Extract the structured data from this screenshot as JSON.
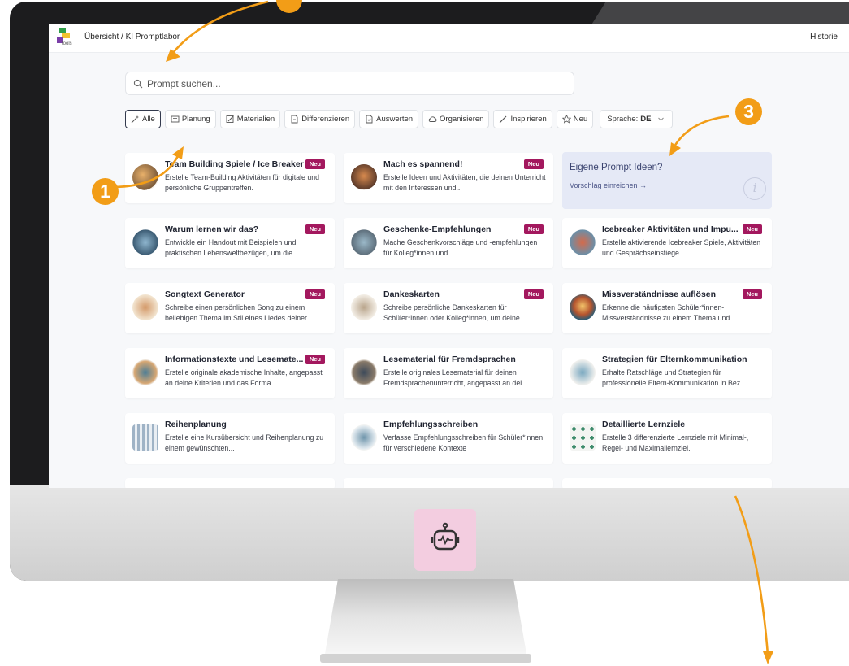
{
  "topbar": {
    "breadcrumb": "Übersicht / KI Promptlabor",
    "history": "Historie",
    "logo_text": "tools"
  },
  "search": {
    "placeholder": "Prompt suchen..."
  },
  "filters": {
    "all": "Alle",
    "planning": "Planung",
    "materials": "Materialien",
    "differentiate": "Differenzieren",
    "evaluate": "Auswerten",
    "organize": "Organisieren",
    "inspire": "Inspirieren",
    "new": "Neu",
    "language_label": "Sprache:",
    "language_value": "DE"
  },
  "badge_new": "Neu",
  "proposal": {
    "title": "Eigene Prompt Ideen?",
    "link": "Vorschlag einreichen →"
  },
  "cards": [
    {
      "title": "Team Building Spiele / Ice Breaker",
      "description": "Erstelle Team-Building Aktivitäten für digitale und persönliche Gruppentreffen."
    },
    {
      "title": "Mach es spannend!",
      "description": "Erstelle Ideen und Aktivitäten, die deinen Unterricht mit den Interessen und..."
    },
    {
      "title": "Warum lernen wir das?",
      "description": "Entwickle ein Handout mit Beispielen und praktischen Lebensweltbezügen, um die..."
    },
    {
      "title": "Geschenke-Empfehlungen",
      "description": "Mache Geschenkvorschläge und -empfehlungen für Kolleg*innen und..."
    },
    {
      "title": "Icebreaker Aktivitäten und Impu...",
      "description": "Erstelle aktivierende Icebreaker Spiele, Aktivitäten und Gesprächseinstiege."
    },
    {
      "title": "Songtext Generator",
      "description": "Schreibe einen persönlichen Song zu einem beliebigen Thema im Stil eines Liedes deiner..."
    },
    {
      "title": "Dankeskarten",
      "description": "Schreibe persönliche Dankeskarten für Schüler*innen oder Kolleg*innen, um deine..."
    },
    {
      "title": "Missverständnisse auflösen",
      "description": "Erkenne die häufigsten Schüler*innen-Missverständnisse zu einem Thema und..."
    },
    {
      "title": "Informationstexte und Lesemate...",
      "description": "Erstelle originale akademische Inhalte, angepasst an deine Kriterien und das Forma..."
    },
    {
      "title": "Lesematerial für Fremdsprachen",
      "description": "Erstelle originales Lesematerial für deinen Fremdsprachenunterricht, angepasst an dei..."
    },
    {
      "title": "Strategien für Elternkommunikation",
      "description": "Erhalte Ratschläge und Strategien für professionelle Eltern-Kommunikation in Bez..."
    },
    {
      "title": "Reihenplanung",
      "description": "Erstelle eine Kursübersicht und Reihenplanung zu einem gewünschten..."
    },
    {
      "title": "Empfehlungsschreiben",
      "description": "Verfasse Empfehlungsschreiben für Schüler*innen für verschiedene Kontexte"
    },
    {
      "title": "Detaillierte Lernziele",
      "description": "Erstelle 3 differenzierte Lernziele mit Minimal-, Regel- und Maximallernziel."
    }
  ],
  "callouts": {
    "one": "1",
    "three": "3"
  },
  "colors": {
    "accent_orange": "#f29d17",
    "badge_new": "#a3185e",
    "proposal_bg": "#e5e9f6",
    "robot_tile": "#f3cde0"
  },
  "icons": [
    "search-icon",
    "wand-icon",
    "planning-icon",
    "edit-icon",
    "document-icon",
    "check-document-icon",
    "cloud-icon",
    "pen-icon",
    "star-icon",
    "chevron-down-icon",
    "info-icon",
    "robot-icon"
  ]
}
